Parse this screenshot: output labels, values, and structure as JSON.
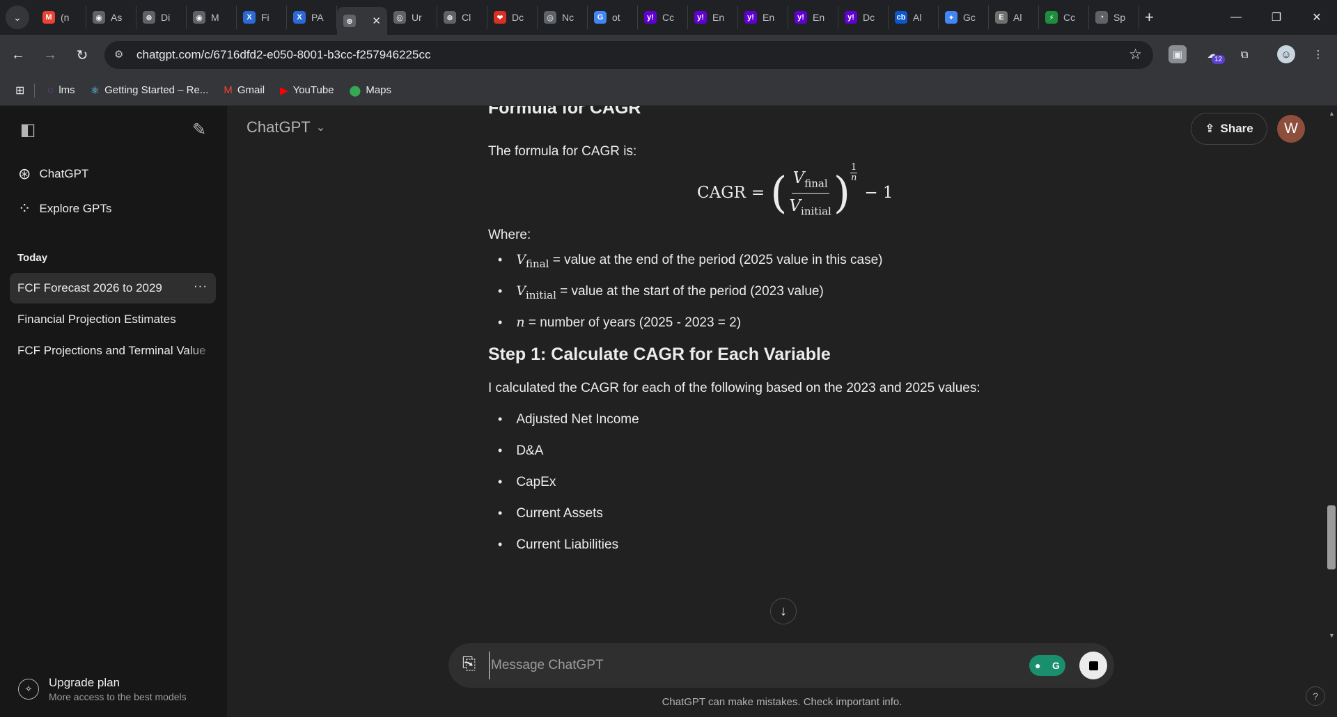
{
  "browser": {
    "tabs": [
      {
        "label": "(n",
        "fav": "M",
        "color": "#ea4335"
      },
      {
        "label": "As",
        "fav": "◉",
        "color": "#5f6368"
      },
      {
        "label": "Di",
        "fav": "⊛",
        "color": "#5f6368"
      },
      {
        "label": "M",
        "fav": "◉",
        "color": "#5f6368"
      },
      {
        "label": "Fi",
        "fav": "X",
        "color": "#2b6ad6"
      },
      {
        "label": "PA",
        "fav": "X",
        "color": "#2b6ad6"
      },
      {
        "label": "",
        "fav": "⊛",
        "color": "#5f6368",
        "active": true
      },
      {
        "label": "Ur",
        "fav": "◎",
        "color": "#5f6368"
      },
      {
        "label": "Cl",
        "fav": "⊛",
        "color": "#5f6368"
      },
      {
        "label": "Dc",
        "fav": "❤",
        "color": "#d93025"
      },
      {
        "label": "Nc",
        "fav": "◎",
        "color": "#5f6368"
      },
      {
        "label": "ot",
        "fav": "G",
        "color": "#4285f4"
      },
      {
        "label": "Cc",
        "fav": "y!",
        "color": "#6001d2"
      },
      {
        "label": "En",
        "fav": "y!",
        "color": "#6001d2"
      },
      {
        "label": "En",
        "fav": "y!",
        "color": "#6001d2"
      },
      {
        "label": "En",
        "fav": "y!",
        "color": "#6001d2"
      },
      {
        "label": "Dc",
        "fav": "y!",
        "color": "#6001d2"
      },
      {
        "label": "Al",
        "fav": "cb",
        "color": "#0b57d0"
      },
      {
        "label": "Gc",
        "fav": "✦",
        "color": "#4285f4"
      },
      {
        "label": "Al",
        "fav": "E",
        "color": "#6f6f6f"
      },
      {
        "label": "Cc",
        "fav": "⚡",
        "color": "#1e8e3e"
      },
      {
        "label": "Sp",
        "fav": "◔",
        "color": "#5f6368"
      }
    ],
    "url": "chatgpt.com/c/6716dfd2-e050-8001-b3cc-f257946225cc",
    "extension_badge": "12",
    "bookmarks": [
      {
        "label": "lms",
        "icon": "◌"
      },
      {
        "label": "Getting Started – Re...",
        "icon": "⚛"
      },
      {
        "label": "Gmail",
        "icon": "M"
      },
      {
        "label": "YouTube",
        "icon": "▶"
      },
      {
        "label": "Maps",
        "icon": "⬤"
      }
    ]
  },
  "sidebar": {
    "nav": [
      {
        "label": "ChatGPT",
        "icon": "⊛"
      },
      {
        "label": "Explore GPTs",
        "icon": "⁘"
      }
    ],
    "section_today": "Today",
    "chats": [
      {
        "label": "FCF Forecast 2026 to 2029",
        "active": true
      },
      {
        "label": "Financial Projection Estimates"
      },
      {
        "label": "FCF Projections and Terminal Value"
      }
    ],
    "chat_more": "···",
    "upgrade_title": "Upgrade plan",
    "upgrade_sub": "More access to the best models"
  },
  "header": {
    "model": "ChatGPT",
    "share": "Share",
    "avatar": "W"
  },
  "message": {
    "cut_heading": "Formula for CAGR",
    "intro": "The formula for CAGR is:",
    "formula": {
      "lhs": "CAGR",
      "eq": "=",
      "num_var": "V",
      "num_sub": "final",
      "den_var": "V",
      "den_sub": "initial",
      "exp_num": "1",
      "exp_den": "n",
      "tail": "− 1"
    },
    "where": "Where:",
    "defs": [
      {
        "var": "V",
        "sub": "final",
        "text": "= value at the end of the period (2025 value in this case)"
      },
      {
        "var": "V",
        "sub": "initial",
        "text": "= value at the start of the period (2023 value)"
      },
      {
        "var": "n",
        "sub": "",
        "text": "= number of years (2025 - 2023 = 2)"
      }
    ],
    "step1_heading": "Step 1: Calculate CAGR for Each Variable",
    "step1_intro": "I calculated the CAGR for each of the following based on the 2023 and 2025 values:",
    "variables": [
      "Adjusted Net Income",
      "D&A",
      "CapEx",
      "Current Assets",
      "Current Liabilities"
    ]
  },
  "composer": {
    "placeholder": "Message ChatGPT"
  },
  "disclaimer": "ChatGPT can make mistakes. Check important info.",
  "help": "?"
}
